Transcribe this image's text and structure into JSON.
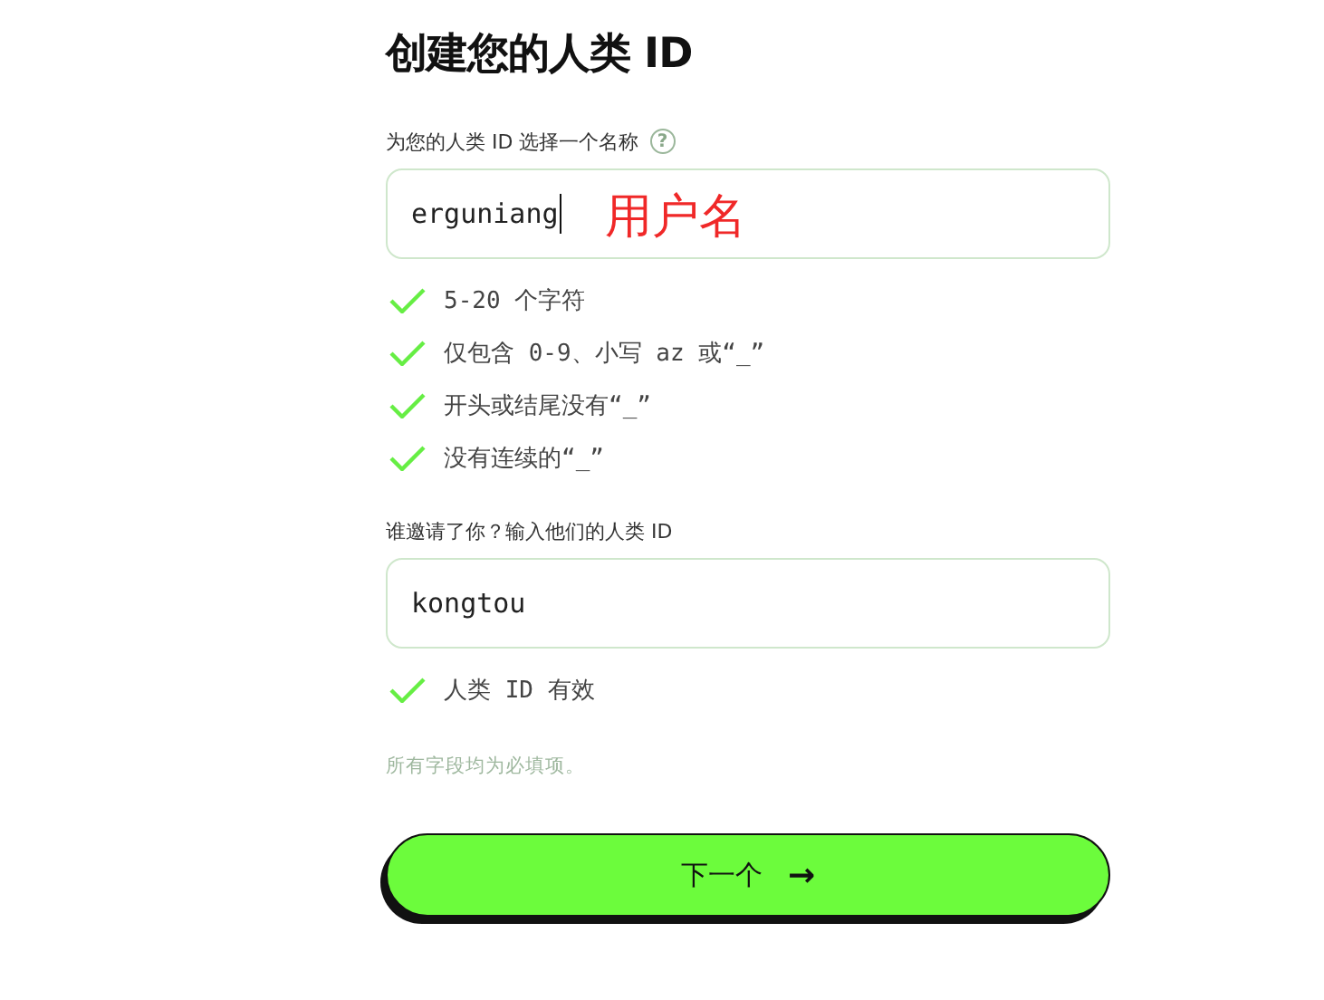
{
  "title": "创建您的人类 ID",
  "username": {
    "label": "为您的人类 ID 选择一个名称",
    "help": "?",
    "value": "erguniang",
    "focused": true,
    "annotation": "用户名",
    "rules": [
      {
        "text": "5-20 个字符",
        "met": true
      },
      {
        "text": "仅包含 0-9、小写 az 或“_”",
        "met": true
      },
      {
        "text": "开头或结尾没有“_”",
        "met": true
      },
      {
        "text": "没有连续的“_”",
        "met": true
      }
    ]
  },
  "referrer": {
    "label": "谁邀请了你？输入他们的人类 ID",
    "value": "kongtou",
    "rules": [
      {
        "text": "人类 ID 有效",
        "met": true
      }
    ]
  },
  "note": "所有字段均为必填项。",
  "next_button": {
    "label": "下一个",
    "icon": "→"
  }
}
